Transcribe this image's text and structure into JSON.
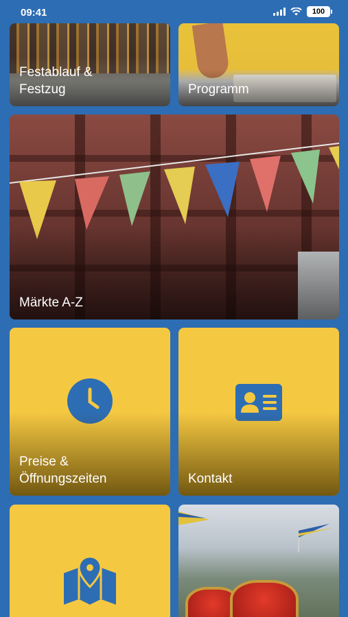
{
  "status_bar": {
    "time": "09:41",
    "battery": "100"
  },
  "tiles": {
    "festablauf": {
      "label": "Festablauf &\nFestzug"
    },
    "programm": {
      "label": "Programm"
    },
    "maerkte": {
      "label": "Märkte A-Z"
    },
    "preise": {
      "label": "Preise &\nÖffnungszeiten",
      "icon": "clock-icon"
    },
    "kontakt": {
      "label": "Kontakt",
      "icon": "contact-card-icon"
    },
    "karte": {
      "label": "",
      "icon": "map-pin-icon"
    },
    "kronen": {
      "label": ""
    }
  },
  "colors": {
    "background": "#2d6db3",
    "tile_yellow": "#f5c842",
    "icon_blue": "#2d6db3"
  }
}
